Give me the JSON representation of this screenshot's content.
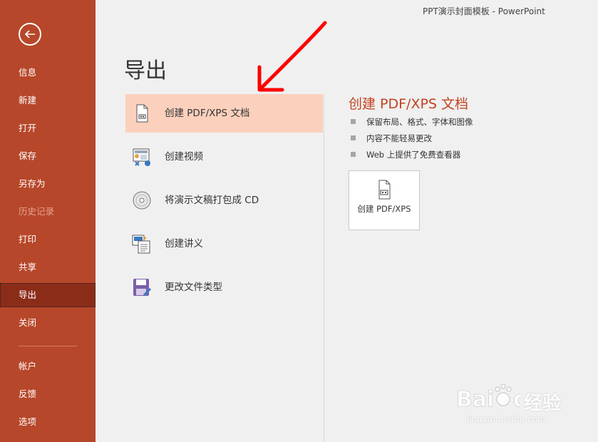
{
  "window": {
    "title": "PPT演示封面模板  -  PowerPoint"
  },
  "sidebar": {
    "items": [
      {
        "label": "信息"
      },
      {
        "label": "新建"
      },
      {
        "label": "打开"
      },
      {
        "label": "保存"
      },
      {
        "label": "另存为"
      },
      {
        "label": "历史记录",
        "disabled": true
      },
      {
        "label": "打印"
      },
      {
        "label": "共享"
      },
      {
        "label": "导出",
        "active": true
      },
      {
        "label": "关闭"
      },
      {
        "label": "帐户"
      },
      {
        "label": "反馈"
      },
      {
        "label": "选项"
      }
    ]
  },
  "page": {
    "heading": "导出"
  },
  "options": [
    {
      "label": "创建 PDF/XPS 文档",
      "icon": "pdf-document-icon",
      "selected": true
    },
    {
      "label": "创建视频",
      "icon": "video-icon"
    },
    {
      "label": "将演示文稿打包成 CD",
      "icon": "cd-icon"
    },
    {
      "label": "创建讲义",
      "icon": "handout-icon"
    },
    {
      "label": "更改文件类型",
      "icon": "save-file-type-icon"
    }
  ],
  "detail": {
    "title": "创建 PDF/XPS 文档",
    "bullets": [
      "保留布局、格式、字体和图像",
      "内容不能轻易更改",
      "Web 上提供了免费查看器"
    ],
    "button_label": "创建 PDF/XPS"
  },
  "watermark": {
    "brand": "Bai du 经验",
    "brand_cn": "经验",
    "url": "jingyan.baidu.com"
  },
  "colors": {
    "sidebar": "#b7472a",
    "active": "#8b2c19",
    "selected": "#fbd0bc",
    "accent": "#c3421f",
    "annotation": "#ff0000"
  }
}
